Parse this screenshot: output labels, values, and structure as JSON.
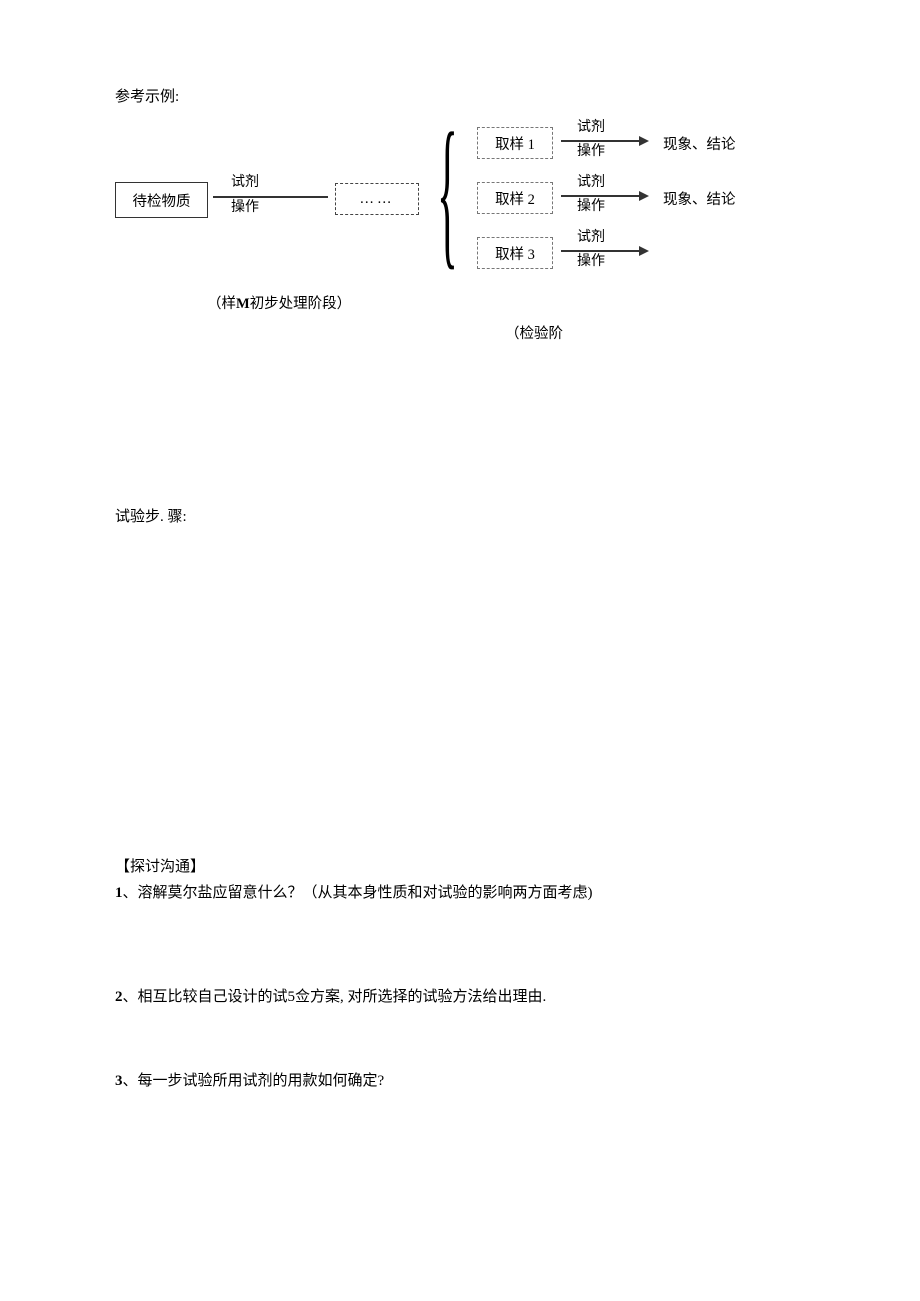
{
  "header": {
    "ref_example": "参考示例:"
  },
  "diagram": {
    "pending_box": "待检物质",
    "reagent_top": "试剂",
    "reagent_bottom": "操作",
    "dots": "……",
    "sample1": "取样 1",
    "sample2": "取样 2",
    "sample3": "取样 3",
    "result": "现象、结论",
    "caption_left": "（样M初步处理阶段）",
    "caption_right": "（检验阶"
  },
  "steps": {
    "label": "试验步. 骤:"
  },
  "discuss": {
    "title": "【探讨沟通】",
    "q1_num": "1",
    "q1": "、溶解莫尔盐应留意什么？（从其本身性质和对试验的影响两方面考虑)",
    "q2_num": "2",
    "q2": "、相互比较自己设计的试5佥方案, 对所选择的试验方法给出理由.",
    "q3_num": "3",
    "q3": "、每一步试验所用试剂的用款如何确定?"
  }
}
